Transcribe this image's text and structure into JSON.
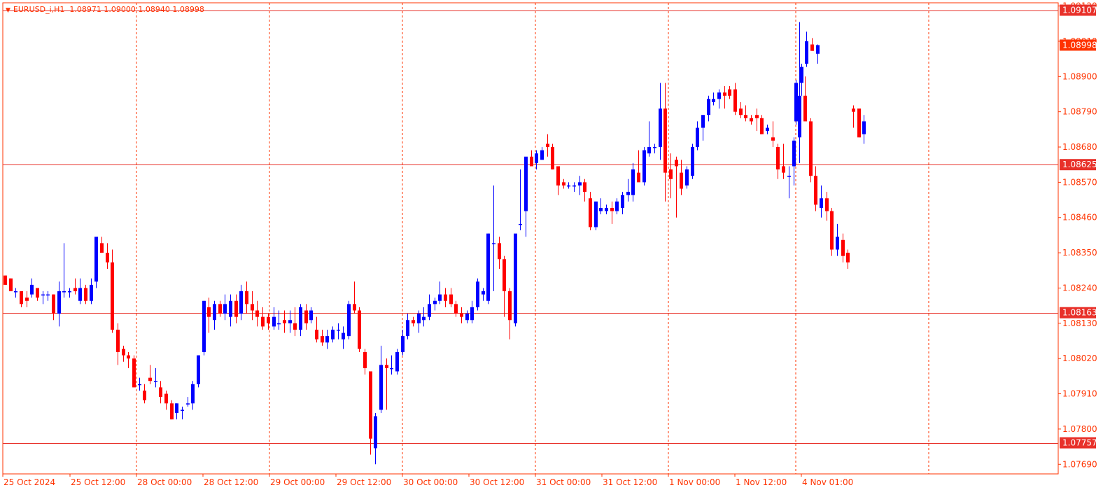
{
  "header": {
    "triangle": "▼",
    "symbol": "EURUSD_i,H1",
    "ohlc": "1.08971 1.09000 1.08940 1.08998"
  },
  "colors": {
    "background": "#ffffff",
    "axis": "#ff3300",
    "grid": "#ff3300",
    "bull": "#0000ff",
    "bear": "#ff0000",
    "level_line": "#e8312a",
    "level_box": "#e8312a",
    "bid_box": "#ff3300"
  },
  "price_axis": {
    "ticks": [
      "1.09120",
      "1.09010",
      "1.08900",
      "1.08790",
      "1.08680",
      "1.08570",
      "1.08460",
      "1.08350",
      "1.08240",
      "1.08130",
      "1.08020",
      "1.07910",
      "1.07800",
      "1.07690"
    ]
  },
  "time_axis": {
    "labels": [
      "25 Oct 2024",
      "25 Oct 12:00",
      "28 Oct 00:00",
      "28 Oct 12:00",
      "29 Oct 00:00",
      "29 Oct 12:00",
      "30 Oct 00:00",
      "30 Oct 12:00",
      "31 Oct 00:00",
      "31 Oct 12:00",
      "1 Nov 00:00",
      "1 Nov 12:00",
      "4 Nov 01:00"
    ]
  },
  "levels": [
    "1.09107",
    "1.08625",
    "1.08163",
    "1.07757"
  ],
  "bid": "1.08998",
  "chart_data": {
    "type": "candlestick",
    "symbol": "EURUSD_i",
    "timeframe": "H1",
    "y_range": [
      1.0766,
      1.0913
    ],
    "horizontal_levels": [
      1.09107,
      1.08625,
      1.08163,
      1.07757
    ],
    "bid": 1.08998,
    "candles": [
      [
        1.08279,
        1.08279,
        1.0825,
        1.0825
      ],
      [
        1.0827,
        1.0827,
        1.0823,
        1.0823
      ],
      [
        1.0823,
        1.0824,
        1.0821,
        1.0823
      ],
      [
        1.0823,
        1.0823,
        1.0818,
        1.0819
      ],
      [
        1.0821,
        1.0823,
        1.0818,
        1.082
      ],
      [
        1.0822,
        1.0827,
        1.0821,
        1.0825
      ],
      [
        1.0824,
        1.0824,
        1.082,
        1.0821
      ],
      [
        1.0822,
        1.0823,
        1.0819,
        1.0822
      ],
      [
        1.0822,
        1.0823,
        1.082,
        1.0822
      ],
      [
        1.0822,
        1.0822,
        1.0814,
        1.0816
      ],
      [
        1.0816,
        1.0826,
        1.0812,
        1.0823
      ],
      [
        1.0823,
        1.0838,
        1.0821,
        1.0823
      ],
      [
        1.0823,
        1.0824,
        1.0821,
        1.0823
      ],
      [
        1.0824,
        1.0827,
        1.0822,
        1.0823
      ],
      [
        1.082,
        1.0827,
        1.0819,
        1.0824
      ],
      [
        1.0824,
        1.0825,
        1.0819,
        1.082
      ],
      [
        1.082,
        1.0827,
        1.0819,
        1.0825
      ],
      [
        1.0826,
        1.0839,
        1.0824,
        1.084
      ],
      [
        1.0838,
        1.084,
        1.0835,
        1.0835
      ],
      [
        1.0835,
        1.0838,
        1.083,
        1.0832
      ],
      [
        1.0832,
        1.0836,
        1.081,
        1.0811
      ],
      [
        1.0811,
        1.0813,
        1.08,
        1.0804
      ],
      [
        1.0805,
        1.0806,
        1.0801,
        1.0803
      ],
      [
        1.0803,
        1.0804,
        1.0799,
        1.0802
      ],
      [
        1.0802,
        1.0803,
        1.0793,
        1.0793
      ],
      [
        1.0794,
        1.0796,
        1.0792,
        1.0794
      ],
      [
        1.0792,
        1.0794,
        1.0788,
        1.0789
      ],
      [
        1.0796,
        1.08,
        1.0794,
        1.0795
      ],
      [
        1.0795,
        1.0799,
        1.0793,
        1.0795
      ],
      [
        1.0793,
        1.0795,
        1.0788,
        1.079
      ],
      [
        1.0791,
        1.0792,
        1.0786,
        1.0788
      ],
      [
        1.0788,
        1.0789,
        1.0783,
        1.0783
      ],
      [
        1.0785,
        1.0788,
        1.0783,
        1.0788
      ],
      [
        1.0786,
        1.0787,
        1.0783,
        1.0786
      ],
      [
        1.0788,
        1.079,
        1.0787,
        1.0788
      ],
      [
        1.0788,
        1.0795,
        1.0786,
        1.0794
      ],
      [
        1.0794,
        1.0803,
        1.0793,
        1.0803
      ],
      [
        1.0804,
        1.082,
        1.0803,
        1.082
      ],
      [
        1.0818,
        1.0821,
        1.081,
        1.0815
      ],
      [
        1.0814,
        1.082,
        1.0811,
        1.0819
      ],
      [
        1.0819,
        1.082,
        1.0815,
        1.0816
      ],
      [
        1.0816,
        1.0822,
        1.0814,
        1.0819
      ],
      [
        1.0815,
        1.0822,
        1.0812,
        1.082
      ],
      [
        1.082,
        1.0822,
        1.0813,
        1.0815
      ],
      [
        1.0816,
        1.0825,
        1.0814,
        1.0823
      ],
      [
        1.0823,
        1.0826,
        1.0816,
        1.0819
      ],
      [
        1.0819,
        1.0823,
        1.0814,
        1.0817
      ],
      [
        1.0817,
        1.082,
        1.0812,
        1.0815
      ],
      [
        1.0815,
        1.0818,
        1.0811,
        1.0812
      ],
      [
        1.0815,
        1.0816,
        1.0811,
        1.0813
      ],
      [
        1.0812,
        1.0818,
        1.0811,
        1.0815
      ],
      [
        1.0813,
        1.0817,
        1.0811,
        1.0813
      ],
      [
        1.0814,
        1.0817,
        1.081,
        1.0813
      ],
      [
        1.0813,
        1.0817,
        1.081,
        1.0814
      ],
      [
        1.0813,
        1.0818,
        1.0809,
        1.0811
      ],
      [
        1.0811,
        1.0819,
        1.0809,
        1.0818
      ],
      [
        1.0817,
        1.0819,
        1.0811,
        1.0813
      ],
      [
        1.0814,
        1.0818,
        1.0813,
        1.0817
      ],
      [
        1.0811,
        1.0815,
        1.0807,
        1.0808
      ],
      [
        1.0809,
        1.0811,
        1.0806,
        1.0807
      ],
      [
        1.0807,
        1.0811,
        1.0805,
        1.0809
      ],
      [
        1.0808,
        1.0812,
        1.0807,
        1.0811
      ],
      [
        1.0811,
        1.0813,
        1.0808,
        1.0811
      ],
      [
        1.0808,
        1.0812,
        1.0805,
        1.081
      ],
      [
        1.0809,
        1.082,
        1.0808,
        1.0819
      ],
      [
        1.0819,
        1.0826,
        1.0816,
        1.0817
      ],
      [
        1.0817,
        1.0818,
        1.0804,
        1.0805
      ],
      [
        1.0804,
        1.0805,
        1.0797,
        1.0799
      ],
      [
        1.0798,
        1.0798,
        1.0772,
        1.0777
      ],
      [
        1.0774,
        1.0785,
        1.0769,
        1.0784
      ],
      [
        1.0786,
        1.0806,
        1.0785,
        1.08
      ],
      [
        1.08,
        1.0802,
        1.0786,
        1.0799
      ],
      [
        1.0799,
        1.0803,
        1.0797,
        1.0799
      ],
      [
        1.0798,
        1.0805,
        1.0797,
        1.0804
      ],
      [
        1.0804,
        1.0811,
        1.0803,
        1.0809
      ],
      [
        1.0809,
        1.0816,
        1.0808,
        1.0814
      ],
      [
        1.0814,
        1.0815,
        1.0812,
        1.0813
      ],
      [
        1.0813,
        1.0817,
        1.081,
        1.0816
      ],
      [
        1.0814,
        1.0818,
        1.0812,
        1.0815
      ],
      [
        1.0815,
        1.0822,
        1.0814,
        1.0819
      ],
      [
        1.0819,
        1.0821,
        1.0817,
        1.082
      ],
      [
        1.082,
        1.0826,
        1.0819,
        1.0822
      ],
      [
        1.0822,
        1.0824,
        1.0818,
        1.082
      ],
      [
        1.0822,
        1.0824,
        1.0818,
        1.0819
      ],
      [
        1.0819,
        1.082,
        1.0815,
        1.0816
      ],
      [
        1.0816,
        1.0818,
        1.0813,
        1.0815
      ],
      [
        1.0814,
        1.0817,
        1.0813,
        1.0816
      ],
      [
        1.0814,
        1.082,
        1.0813,
        1.0818
      ],
      [
        1.0818,
        1.0827,
        1.0817,
        1.0826
      ],
      [
        1.0822,
        1.0824,
        1.082,
        1.0823
      ],
      [
        1.082,
        1.0841,
        1.0819,
        1.0841
      ],
      [
        1.0838,
        1.0856,
        1.0823,
        1.0838
      ],
      [
        1.0838,
        1.084,
        1.083,
        1.0833
      ],
      [
        1.0833,
        1.0834,
        1.0815,
        1.0823
      ],
      [
        1.0823,
        1.0824,
        1.0808,
        1.0814
      ],
      [
        1.0813,
        1.084,
        1.0812,
        1.0841
      ],
      [
        1.0844,
        1.0861,
        1.0842,
        1.0844
      ],
      [
        1.0848,
        1.086,
        1.084,
        1.0865
      ],
      [
        1.0865,
        1.0867,
        1.0864,
        1.0862
      ],
      [
        1.0863,
        1.0867,
        1.0861,
        1.0866
      ],
      [
        1.0864,
        1.0868,
        1.0864,
        1.0867
      ],
      [
        1.0869,
        1.0872,
        1.0865,
        1.0868
      ],
      [
        1.0868,
        1.0869,
        1.0861,
        1.0861
      ],
      [
        1.0862,
        1.0862,
        1.0853,
        1.0856
      ],
      [
        1.0857,
        1.0858,
        1.0855,
        1.0856
      ],
      [
        1.0856,
        1.0857,
        1.0855,
        1.0856
      ],
      [
        1.0856,
        1.0857,
        1.0854,
        1.0856
      ],
      [
        1.0856,
        1.0859,
        1.0853,
        1.0857
      ],
      [
        1.0857,
        1.0858,
        1.0851,
        1.0854
      ],
      [
        1.0852,
        1.0854,
        1.0842,
        1.0843
      ],
      [
        1.0843,
        1.0851,
        1.0842,
        1.0851
      ],
      [
        1.0848,
        1.0852,
        1.0847,
        1.0849
      ],
      [
        1.0848,
        1.085,
        1.0847,
        1.0849
      ],
      [
        1.0849,
        1.0851,
        1.0844,
        1.0848
      ],
      [
        1.0848,
        1.0852,
        1.0847,
        1.0851
      ],
      [
        1.0849,
        1.0854,
        1.0847,
        1.0853
      ],
      [
        1.0853,
        1.0858,
        1.0851,
        1.0854
      ],
      [
        1.0853,
        1.0863,
        1.0851,
        1.0861
      ],
      [
        1.086,
        1.0867,
        1.0859,
        1.0857
      ],
      [
        1.0857,
        1.0868,
        1.0856,
        1.0867
      ],
      [
        1.0866,
        1.0876,
        1.0865,
        1.0868
      ],
      [
        1.0868,
        1.0869,
        1.0866,
        1.0868
      ],
      [
        1.0868,
        1.0888,
        1.0864,
        1.088
      ],
      [
        1.088,
        1.0888,
        1.0851,
        1.086
      ],
      [
        1.0861,
        1.0866,
        1.0852,
        1.0858
      ],
      [
        1.0864,
        1.0865,
        1.0846,
        1.0862
      ],
      [
        1.086,
        1.0864,
        1.0853,
        1.0855
      ],
      [
        1.0856,
        1.0862,
        1.0855,
        1.0861
      ],
      [
        1.0859,
        1.0869,
        1.0858,
        1.0868
      ],
      [
        1.0868,
        1.0876,
        1.0867,
        1.0874
      ],
      [
        1.0874,
        1.0878,
        1.087,
        1.0878
      ],
      [
        1.0878,
        1.0884,
        1.0876,
        1.0883
      ],
      [
        1.0882,
        1.0885,
        1.0881,
        1.0883
      ],
      [
        1.0883,
        1.0886,
        1.088,
        1.0885
      ],
      [
        1.0885,
        1.0887,
        1.088,
        1.0884
      ],
      [
        1.0886,
        1.0887,
        1.0883,
        1.0884
      ],
      [
        1.0886,
        1.0888,
        1.0878,
        1.0879
      ],
      [
        1.088,
        1.0882,
        1.0877,
        1.0878
      ],
      [
        1.0878,
        1.0881,
        1.0876,
        1.0877
      ],
      [
        1.0877,
        1.0878,
        1.0875,
        1.0876
      ],
      [
        1.0878,
        1.088,
        1.0873,
        1.0877
      ],
      [
        1.0877,
        1.0878,
        1.0872,
        1.0872
      ],
      [
        1.0873,
        1.0875,
        1.0872,
        1.0874
      ],
      [
        1.0871,
        1.0876,
        1.0868,
        1.087
      ],
      [
        1.0868,
        1.0869,
        1.0858,
        1.0861
      ],
      [
        1.0862,
        1.0869,
        1.0858,
        1.086
      ],
      [
        1.0859,
        1.0862,
        1.0852,
        1.0859
      ],
      [
        1.0862,
        1.0871,
        1.0856,
        1.087
      ],
      [
        1.0871,
        1.0907,
        1.0863,
        1.0884
      ],
      [
        1.0884,
        1.089,
        1.088,
        1.0876
      ],
      [
        1.0876,
        1.0877,
        1.0857,
        1.0859
      ],
      [
        1.0859,
        1.0862,
        1.0848,
        1.085
      ],
      [
        1.0849,
        1.0856,
        1.0846,
        1.0852
      ],
      [
        1.0852,
        1.0854,
        1.0845,
        1.0848
      ],
      [
        1.0848,
        1.0849,
        1.0834,
        1.0836
      ],
      [
        1.0836,
        1.0844,
        1.0834,
        1.084
      ],
      [
        1.0839,
        1.0841,
        1.0832,
        1.0834
      ],
      [
        1.0835,
        1.0836,
        1.083,
        1.0832
      ],
      [
        1.088,
        1.0881,
        1.0874,
        1.0879
      ],
      [
        1.088,
        1.088,
        1.0871,
        1.0871
      ],
      [
        1.0872,
        1.0878,
        1.0869,
        1.0876
      ],
      [
        1.0876,
        1.0889,
        1.0875,
        1.0888
      ],
      [
        1.0888,
        1.0894,
        1.0884,
        1.0893
      ],
      [
        1.0894,
        1.0904,
        1.0893,
        1.0901
      ],
      [
        1.09,
        1.0902,
        1.0898,
        1.0898
      ],
      [
        1.08971,
        1.09,
        1.0894,
        1.08998
      ]
    ],
    "gap_before_index": 161
  }
}
